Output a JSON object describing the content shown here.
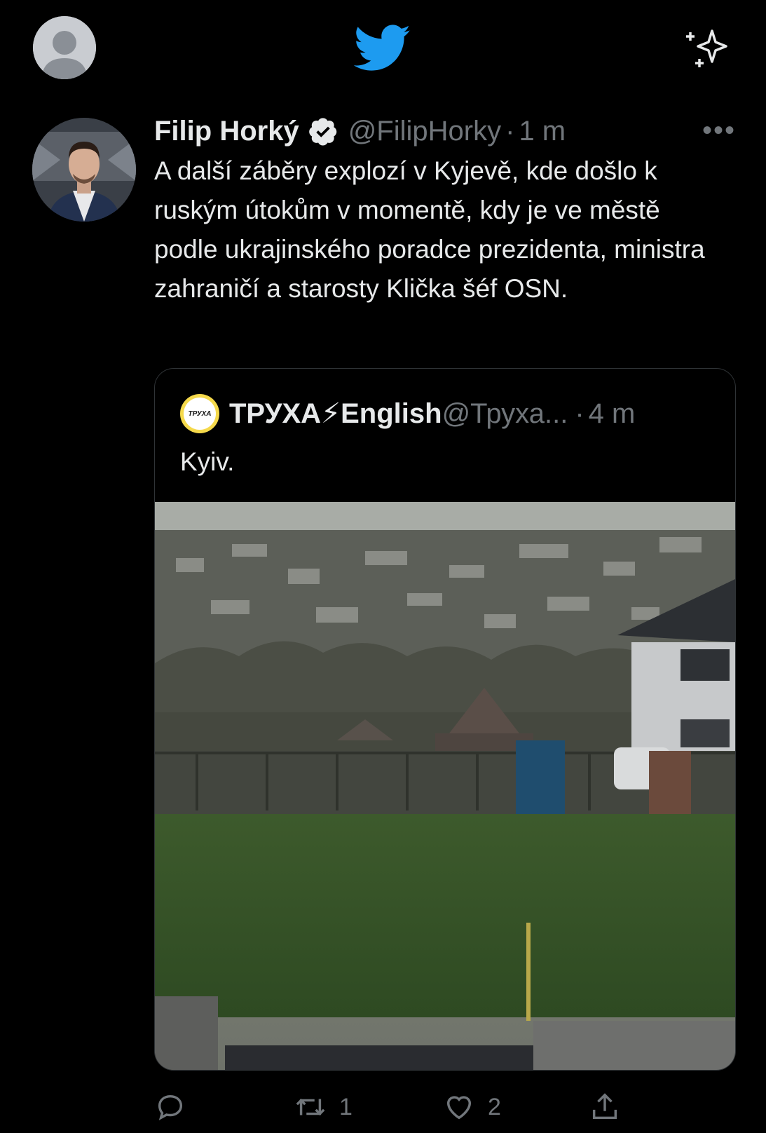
{
  "header": {
    "logo_icon": "twitter-bird-icon",
    "right_icon": "sparkle-icon",
    "brand_color": "#1d9bf0"
  },
  "tweet": {
    "author_name": "Filip Horký",
    "verified": true,
    "handle": "@FilipHorky",
    "separator": "·",
    "time": "1 m",
    "more": "•••",
    "text": "A další záběry explozí v Kyjevě, kde došlo k ruským útokům v momentě, kdy je ve městě podle ukrajinského poradce prezidenta, ministra zahraničí a starosty Klička šéf OSN."
  },
  "quote": {
    "avatar_text": "ТРУХА",
    "name": "ТРУХА⚡English",
    "handle": "@Труха...",
    "separator": "·",
    "time": "4 m",
    "text": "Kyiv."
  },
  "actions": {
    "reply_count": "",
    "retweet_count": "1",
    "like_count": "2"
  }
}
